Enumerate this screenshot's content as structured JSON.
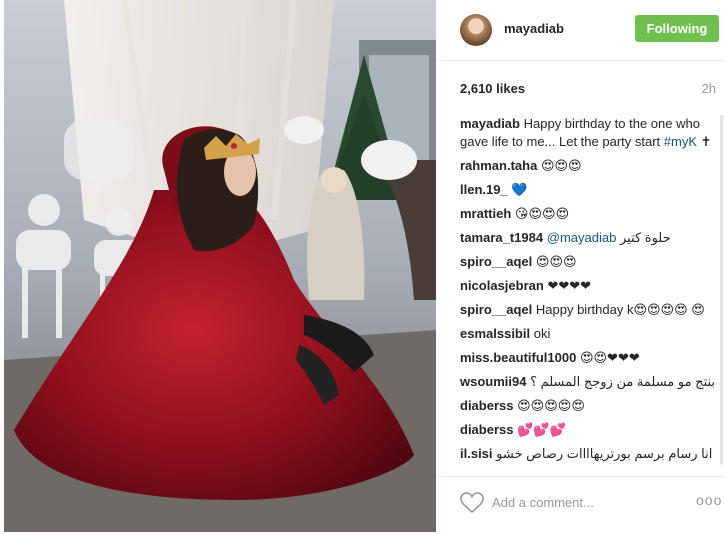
{
  "post": {
    "username": "mayadiab",
    "follow_label": "Following",
    "likes": "2,610 likes",
    "time": "2h",
    "caption": {
      "user": "mayadiab",
      "text": "Happy birthday to the one who gave life to me... Let the party start",
      "hashtag": "#myK",
      "suffix": " ✝"
    },
    "comments": [
      {
        "user": "rahman.taha",
        "text": "😍😍😍"
      },
      {
        "user": "llen.19_",
        "text": "💙"
      },
      {
        "user": "mrattieh",
        "text": "😘😍😍😍"
      },
      {
        "user": "tamara_t1984",
        "mention": "@mayadiab",
        "text": "حلوة كتير"
      },
      {
        "user": "spiro__aqel",
        "text": "😍😍😍"
      },
      {
        "user": "nicolasjebran",
        "text": "❤❤❤❤"
      },
      {
        "user": "spiro__aqel",
        "text": "Happy birthday k😍😍😍😍 😍"
      },
      {
        "user": "esmalssibil",
        "text": "oki"
      },
      {
        "user": "miss.beautiful1000",
        "text": "😍😍❤❤❤"
      },
      {
        "user": "wsoumii94",
        "text": "بنتج مو مسلمة من زوجج المسلم ؟"
      },
      {
        "user": "diaberss",
        "text": "😍😍😍😍😍"
      },
      {
        "user": "diaberss",
        "text": "💕💕💕"
      },
      {
        "user": "il.sisi",
        "text": "انا رسام برسم بورتريهاااات رصاص خشو"
      }
    ],
    "add_comment_placeholder": "Add a comment...",
    "more_label": "ooo"
  },
  "icons": {
    "heart": "heart-icon",
    "more": "more-options-icon"
  },
  "colors": {
    "follow_bg": "#70c050",
    "link": "#125688",
    "muted": "#999999"
  }
}
